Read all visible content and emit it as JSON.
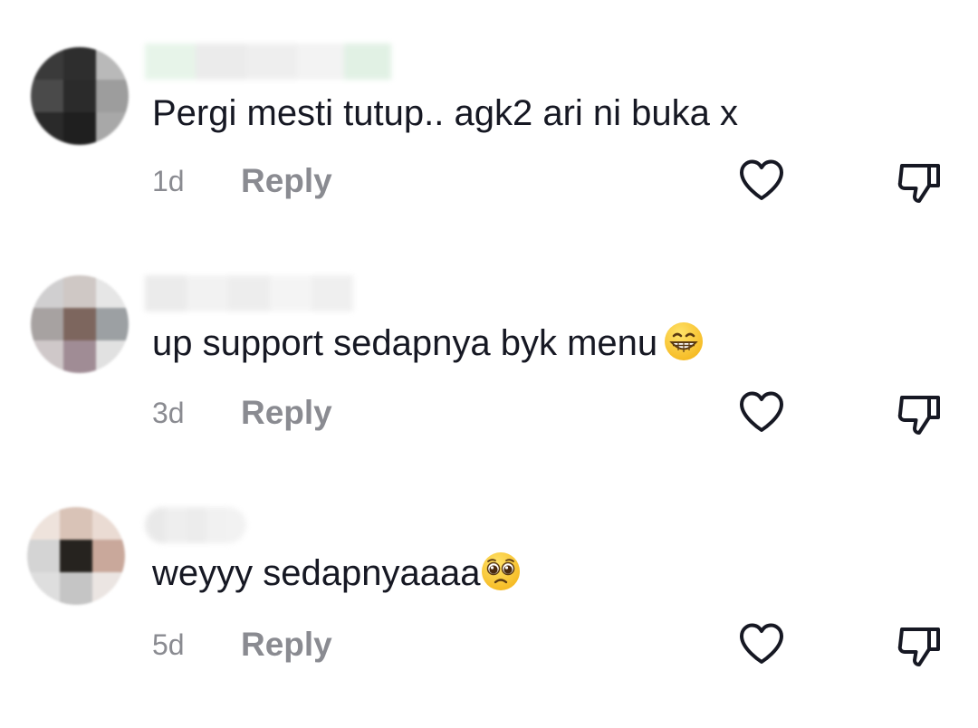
{
  "comments": [
    {
      "username": "",
      "text": "Pergi mesti tutup.. agk2 ari ni buka x",
      "emoji": "",
      "age": "1d",
      "reply_label": "Reply",
      "avatar_colors": [
        "#3a3a3a",
        "#2e2e2e",
        "#b9b9b9",
        "#4a4a4a",
        "#2b2b2b",
        "#9d9d9d",
        "#2a2a2a",
        "#1f1f1f",
        "#a8a8a8"
      ],
      "username_colors": [
        "#e3f3e6",
        "#e8e8e8",
        "#ececec",
        "#f1f1f1",
        "#dcefe0"
      ]
    },
    {
      "username": "",
      "text": "up support sedapnya byk menu",
      "emoji": "grinning-face-icon",
      "age": "3d",
      "reply_label": "Reply",
      "avatar_colors": [
        "#d0cfd0",
        "#cfc8c5",
        "#e6e6e6",
        "#a7a2a1",
        "#7d665e",
        "#9ca0a3",
        "#cfc8c9",
        "#a08c95",
        "#e1e1e1"
      ],
      "username_colors": [
        "#e8e8e8",
        "#f0f0f0",
        "#ebebeb",
        "#f3f3f3",
        "#ededed"
      ]
    },
    {
      "username": "",
      "text": "weyyy sedapnya",
      "text_suffix": "aaa",
      "emoji": "pleading-face-icon",
      "age": "5d",
      "reply_label": "Reply",
      "avatar_colors": [
        "#eee3dc",
        "#d9c3b7",
        "#eadbd3",
        "#d4d4d4",
        "#26231f",
        "#c9a89b",
        "#dedede",
        "#c5c5c5",
        "#ebe5e2"
      ],
      "username_colors": [
        "#e6e6e6",
        "#ececec",
        "#e9e9e9",
        "#efefef",
        "#f0f0f0"
      ]
    }
  ],
  "icons": {
    "like": "heart-outline-icon",
    "dislike": "thumbs-down-outline-icon"
  },
  "colors": {
    "text": "#161823",
    "secondary": "#8a8b91",
    "icon": "#161823"
  }
}
